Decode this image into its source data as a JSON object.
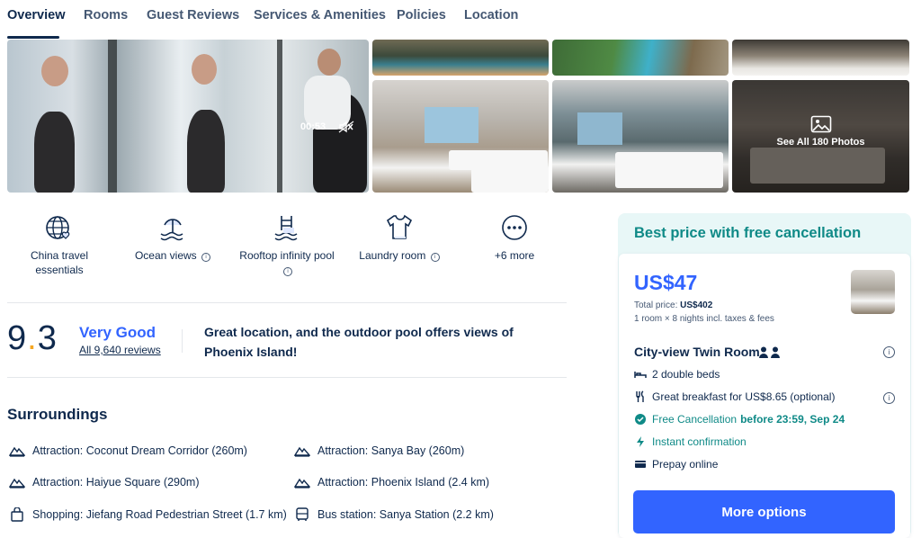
{
  "tabs": [
    {
      "label": "Overview",
      "active": true
    },
    {
      "label": "Rooms"
    },
    {
      "label": "Guest Reviews"
    },
    {
      "label": "Services & Amenities"
    },
    {
      "label": "Policies"
    },
    {
      "label": "Location"
    }
  ],
  "gallery": {
    "video_time": "00:53",
    "see_all_label": "See All 180 Photos"
  },
  "amenities": [
    {
      "label": "China travel essentials",
      "icon": "globe-heart-icon",
      "info": false
    },
    {
      "label": "Ocean views",
      "icon": "beach-umbrella-icon",
      "info": true
    },
    {
      "label": "Rooftop infinity pool",
      "icon": "pool-ladder-icon",
      "info": true
    },
    {
      "label": "Laundry room",
      "icon": "tshirt-icon",
      "info": true
    },
    {
      "label": "+6 more",
      "icon": "more-dots-icon",
      "info": false
    }
  ],
  "rating": {
    "score_int": "9",
    "score_dot": ".",
    "score_dec": "3",
    "label": "Very Good",
    "reviews": "All 9,640 reviews",
    "quote": "Great location, and the outdoor pool offers views of Phoenix Island!"
  },
  "surroundings": {
    "title": "Surroundings",
    "items": [
      {
        "text": "Attraction: Coconut Dream Corridor (260m)",
        "icon": "mountain-icon"
      },
      {
        "text": "Attraction: Sanya Bay (260m)",
        "icon": "mountain-icon"
      },
      {
        "text": "Attraction: Haiyue Square (290m)",
        "icon": "mountain-icon"
      },
      {
        "text": "Attraction: Phoenix Island (2.4 km)",
        "icon": "mountain-icon"
      },
      {
        "text": "Shopping: Jiefang Road Pedestrian Street (1.7 km)",
        "icon": "shopping-bag-icon"
      },
      {
        "text": "Bus station: Sanya Station (2.2 km)",
        "icon": "bus-icon"
      }
    ]
  },
  "booking": {
    "header": "Best price with free cancellation",
    "price": "US$47",
    "total_label": "Total price:",
    "total_value": "US$402",
    "nights": "1 room × 8 nights incl. taxes & fees",
    "room_name": "City-view Twin Room",
    "features": {
      "beds": "2 double beds",
      "breakfast": "Great breakfast for US$8.65 (optional)",
      "cancel_label": "Free Cancellation",
      "cancel_deadline": "before 23:59, Sep 24",
      "instant": "Instant confirmation",
      "prepay": "Prepay online"
    },
    "button": "More options"
  },
  "colors": {
    "primary": "#3264ff",
    "teal": "#0f8a87",
    "text": "#0f294d",
    "star": "#f5a623"
  }
}
